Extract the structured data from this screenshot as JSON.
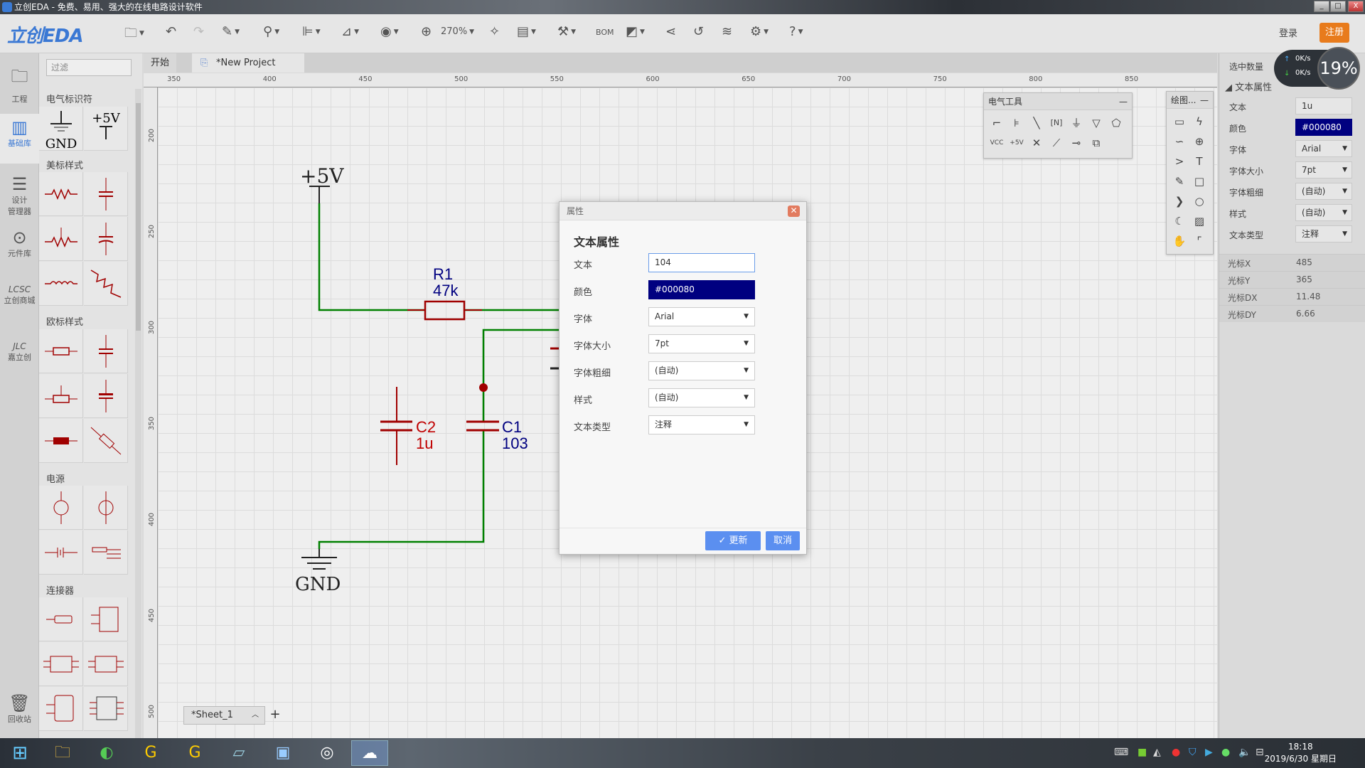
{
  "window": {
    "title": "立创EDA - 免费、易用、强大的在线电路设计软件",
    "min": "_",
    "max": "□",
    "close": "X"
  },
  "toolbar": {
    "logo": "立创EDA",
    "zoom": "270%",
    "bom": "BOM",
    "login": "登录",
    "register": "注册",
    "icons": [
      "folder-icon",
      "undo-icon",
      "redo-icon",
      "pencil-icon",
      "pin-icon",
      "align-icon",
      "measure-icon",
      "eye-icon",
      "zoom-icon",
      "magic-icon",
      "board-icon",
      "tools-icon",
      "bom-icon",
      "fill-icon",
      "share-icon",
      "history-icon",
      "layers-icon",
      "gear-icon",
      "help-icon"
    ]
  },
  "tabs": [
    {
      "label": "开始"
    },
    {
      "label": "*New Project"
    }
  ],
  "leftbar": [
    {
      "label": "工程"
    },
    {
      "label": "基础库"
    },
    {
      "label": "设计\n管理器"
    },
    {
      "label": "元件库"
    },
    {
      "label": "立创商城"
    },
    {
      "label": "嘉立创"
    },
    {
      "label": "回收站"
    }
  ],
  "library": {
    "filter_placeholder": "过滤",
    "sections": [
      "电气标识符",
      "美标样式",
      "欧标样式",
      "电源",
      "连接器"
    ],
    "gnd": "GND",
    "vcc": "+5V"
  },
  "ruler": {
    "h": [
      "350",
      "400",
      "450",
      "500",
      "550",
      "600",
      "650",
      "700",
      "750",
      "800",
      "850"
    ],
    "v": [
      "200",
      "250",
      "300",
      "350",
      "400",
      "450",
      "500"
    ]
  },
  "schematic": {
    "power": "+5V",
    "ground": "GND",
    "r1_ref": "R1",
    "r1_val": "47k",
    "c1_ref": "C1",
    "c1_val": "103",
    "c2_ref": "C2",
    "c2_val": "1u",
    "colors": {
      "wire": "#008000",
      "part": "#a00000",
      "label_blue": "#000080",
      "label_red": "#c00000"
    }
  },
  "panels": {
    "electrical": "电气工具",
    "drawing": "绘图...",
    "minimize": "—",
    "vcc": "VCC",
    "p5v": "+5V"
  },
  "sheet": {
    "name": "*Sheet_1",
    "add": "+"
  },
  "right_panel": {
    "selected_count": "选中数量",
    "section": "文本属性",
    "rows": [
      {
        "label": "文本",
        "value": "1u"
      },
      {
        "label": "颜色",
        "value": "#000080"
      },
      {
        "label": "字体",
        "value": "Arial"
      },
      {
        "label": "字体大小",
        "value": "7pt"
      },
      {
        "label": "字体粗细",
        "value": "(自动)"
      },
      {
        "label": "样式",
        "value": "(自动)"
      },
      {
        "label": "文本类型",
        "value": "注释"
      }
    ],
    "cursor": [
      {
        "label": "光标X",
        "value": "485"
      },
      {
        "label": "光标Y",
        "value": "365"
      },
      {
        "label": "光标DX",
        "value": "11.48"
      },
      {
        "label": "光标DY",
        "value": "6.66"
      }
    ]
  },
  "net": {
    "up": "0K/s",
    "down": "0K/s",
    "cpu": "19%"
  },
  "dialog": {
    "title": "属性",
    "heading": "文本属性",
    "fields": [
      {
        "label": "文本",
        "value": "104"
      },
      {
        "label": "颜色",
        "value": "#000080"
      },
      {
        "label": "字体",
        "value": "Arial"
      },
      {
        "label": "字体大小",
        "value": "7pt"
      },
      {
        "label": "字体粗细",
        "value": "(自动)"
      },
      {
        "label": "样式",
        "value": "(自动)"
      },
      {
        "label": "文本类型",
        "value": "注释"
      }
    ],
    "update": "✓ 更新",
    "cancel": "取消"
  },
  "taskbar": {
    "time": "18:18",
    "date": "2019/6/30 星期日"
  }
}
